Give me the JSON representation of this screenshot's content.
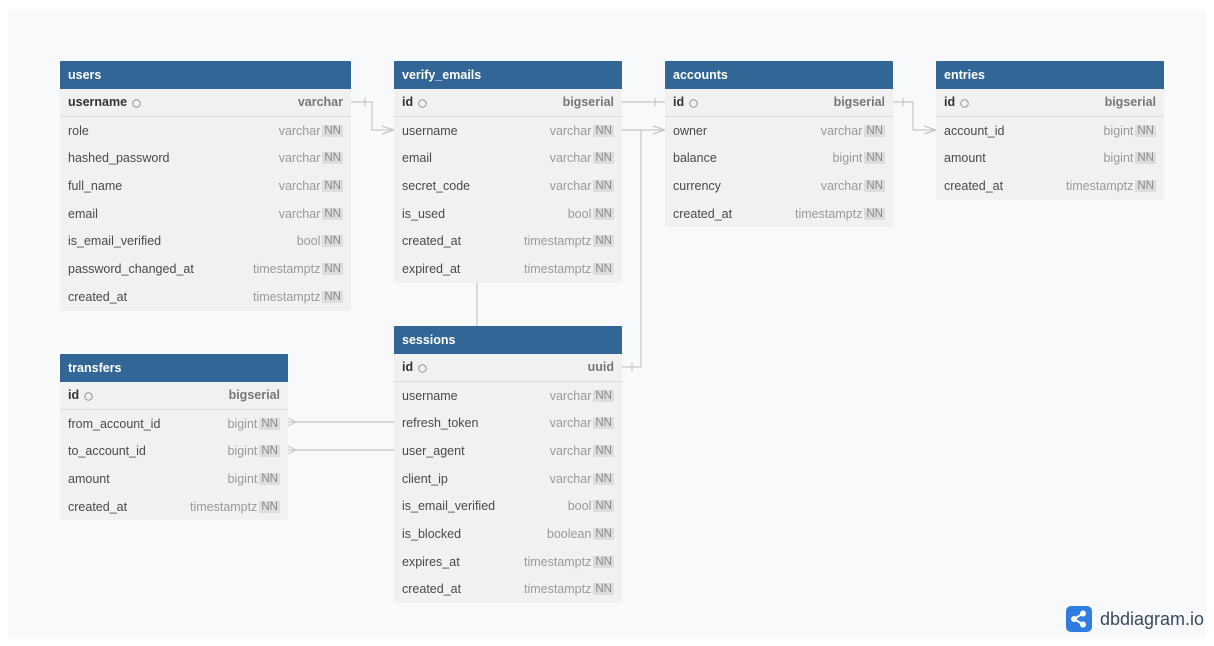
{
  "tables": [
    {
      "name": "users",
      "columns": [
        {
          "name": "username",
          "type": "varchar",
          "pk": true,
          "nn": false
        },
        {
          "name": "role",
          "type": "varchar",
          "nn": true
        },
        {
          "name": "hashed_password",
          "type": "varchar",
          "nn": true
        },
        {
          "name": "full_name",
          "type": "varchar",
          "nn": true
        },
        {
          "name": "email",
          "type": "varchar",
          "nn": true
        },
        {
          "name": "is_email_verified",
          "type": "bool",
          "nn": true
        },
        {
          "name": "password_changed_at",
          "type": "timestamptz",
          "nn": true
        },
        {
          "name": "created_at",
          "type": "timestamptz",
          "nn": true
        }
      ]
    },
    {
      "name": "verify_emails",
      "columns": [
        {
          "name": "id",
          "type": "bigserial",
          "pk": true,
          "nn": false
        },
        {
          "name": "username",
          "type": "varchar",
          "nn": true
        },
        {
          "name": "email",
          "type": "varchar",
          "nn": true
        },
        {
          "name": "secret_code",
          "type": "varchar",
          "nn": true
        },
        {
          "name": "is_used",
          "type": "bool",
          "nn": true
        },
        {
          "name": "created_at",
          "type": "timestamptz",
          "nn": true
        },
        {
          "name": "expired_at",
          "type": "timestamptz",
          "nn": true
        }
      ]
    },
    {
      "name": "accounts",
      "columns": [
        {
          "name": "id",
          "type": "bigserial",
          "pk": true,
          "nn": false
        },
        {
          "name": "owner",
          "type": "varchar",
          "nn": true
        },
        {
          "name": "balance",
          "type": "bigint",
          "nn": true
        },
        {
          "name": "currency",
          "type": "varchar",
          "nn": true
        },
        {
          "name": "created_at",
          "type": "timestamptz",
          "nn": true
        }
      ]
    },
    {
      "name": "entries",
      "columns": [
        {
          "name": "id",
          "type": "bigserial",
          "pk": true,
          "nn": false
        },
        {
          "name": "account_id",
          "type": "bigint",
          "nn": true
        },
        {
          "name": "amount",
          "type": "bigint",
          "nn": true
        },
        {
          "name": "created_at",
          "type": "timestamptz",
          "nn": true
        }
      ]
    },
    {
      "name": "sessions",
      "columns": [
        {
          "name": "id",
          "type": "uuid",
          "pk": true,
          "nn": false
        },
        {
          "name": "username",
          "type": "varchar",
          "nn": true
        },
        {
          "name": "refresh_token",
          "type": "varchar",
          "nn": true
        },
        {
          "name": "user_agent",
          "type": "varchar",
          "nn": true
        },
        {
          "name": "client_ip",
          "type": "varchar",
          "nn": true
        },
        {
          "name": "is_email_verified",
          "type": "bool",
          "nn": true
        },
        {
          "name": "is_blocked",
          "type": "boolean",
          "nn": true
        },
        {
          "name": "expires_at",
          "type": "timestamptz",
          "nn": true
        },
        {
          "name": "created_at",
          "type": "timestamptz",
          "nn": true
        }
      ]
    },
    {
      "name": "transfers",
      "columns": [
        {
          "name": "id",
          "type": "bigserial",
          "pk": true,
          "nn": false
        },
        {
          "name": "from_account_id",
          "type": "bigint",
          "nn": true
        },
        {
          "name": "to_account_id",
          "type": "bigint",
          "nn": true
        },
        {
          "name": "amount",
          "type": "bigint",
          "nn": true
        },
        {
          "name": "created_at",
          "type": "timestamptz",
          "nn": true
        }
      ]
    }
  ],
  "nn_label": "NN",
  "brand": {
    "name": "dbdiagram.io"
  },
  "colors": {
    "header": "#316696",
    "body": "#f1f1f1",
    "line": "#c4c8cc",
    "brand": "#2f7de1"
  }
}
